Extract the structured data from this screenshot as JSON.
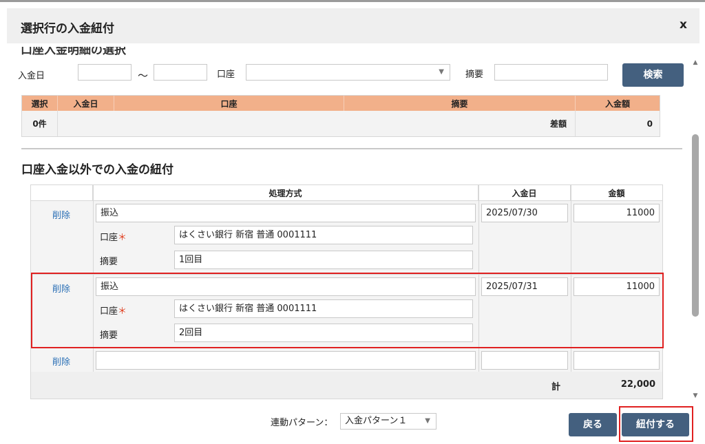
{
  "dialog": {
    "title": "選択行の入金紐付",
    "close": "x"
  },
  "search": {
    "clipped_heading": "口座入金明細の選択",
    "date_label": "入金日",
    "tilde": "～",
    "account_label": "口座",
    "memo_label": "摘要",
    "search_button": "検索"
  },
  "deposit_table": {
    "headers": [
      "選択",
      "入金日",
      "口座",
      "摘要",
      "入金額"
    ],
    "count": "0件",
    "diff_label": "差額",
    "diff_value": "0"
  },
  "section_title": "口座入金以外での入金の紐付",
  "other_table": {
    "headers": {
      "method": "処理方式",
      "date": "入金日",
      "amount": "金額"
    },
    "delete_label": "削除",
    "account_label": "口座",
    "required_mark": "＊",
    "memo_label": "摘要",
    "rows": [
      {
        "method": "振込",
        "date": "2025/07/30",
        "amount": "11000",
        "account": "はくさい銀行 新宿 普通 0001111",
        "memo": "1回目"
      },
      {
        "method": "振込",
        "date": "2025/07/31",
        "amount": "11000",
        "account": "はくさい銀行 新宿 普通 0001111",
        "memo": "2回目"
      }
    ],
    "total_label": "計",
    "total_value": "22,000"
  },
  "footer": {
    "pattern_label": "連動パターン：",
    "pattern_value": "入金パターン１",
    "back_button": "戻る",
    "link_button": "紐付する"
  },
  "colors": {
    "header_orange": "#f2b08a",
    "button_navy": "#44607f",
    "link_blue": "#2a6fb5",
    "highlight_red": "#e02020"
  }
}
